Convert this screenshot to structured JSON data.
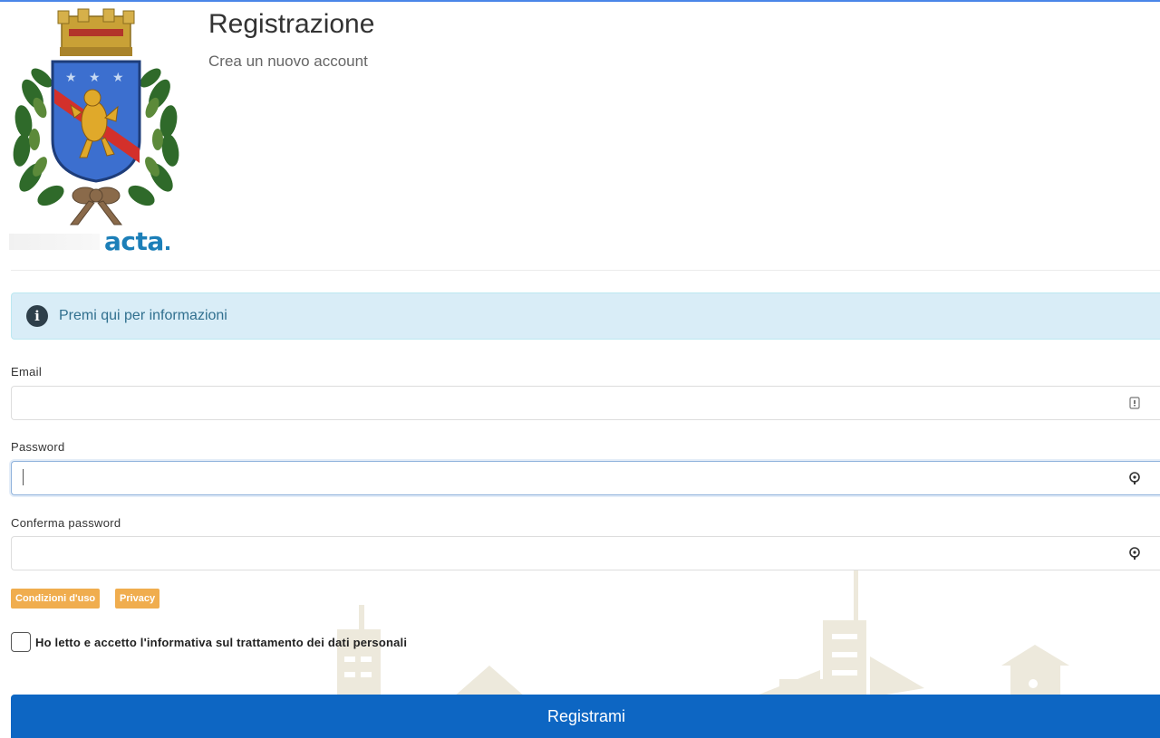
{
  "header": {
    "title": "Registrazione",
    "subtitle": "Crea un nuovo account",
    "brand": "acta"
  },
  "info": {
    "icon": "info-circle-icon",
    "text": "Premi qui per informazioni"
  },
  "form": {
    "email": {
      "label": "Email",
      "value": "",
      "placeholder": "",
      "icon": "autofill-card-icon"
    },
    "password": {
      "label": "Password",
      "value": "",
      "placeholder": "",
      "icon": "password-key-icon"
    },
    "confirm_password": {
      "label": "Conferma password",
      "value": "",
      "placeholder": "",
      "icon": "password-key-icon"
    }
  },
  "links": {
    "terms": "Condizioni d'uso",
    "privacy": "Privacy"
  },
  "consent": {
    "label": "Ho letto e accetto l'informativa sul trattamento dei dati personali",
    "checked": false
  },
  "submit": {
    "label": "Registrami"
  },
  "colors": {
    "accent": "#0d66c3",
    "info_bg": "#d9edf7",
    "info_text": "#31708f",
    "tag": "#f0ad4e",
    "brand": "#1c7fb8"
  }
}
